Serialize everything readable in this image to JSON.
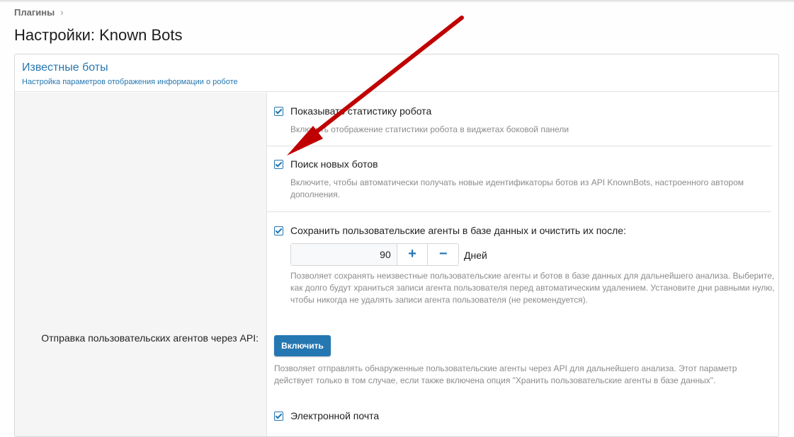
{
  "breadcrumb": {
    "item": "Плагины",
    "sep": "›"
  },
  "page": {
    "title": "Настройки: Known Bots"
  },
  "block": {
    "title": "Известные боты",
    "description": "Настройка параметров отображения информации о роботе"
  },
  "options": [
    {
      "label": "Показывать статистику робота",
      "hint": "Включить отображение статистики робота в виджетах боковой панели",
      "checked": true
    },
    {
      "label": "Поиск новых ботов",
      "hint": "Включите, чтобы автоматически получать новые идентификаторы ботов из API KnownBots, настроенного автором дополнения.",
      "checked": true
    },
    {
      "label": "Сохранить пользовательские агенты в базе данных и очистить их после:",
      "hint": "Позволяет сохранять неизвестные пользовательские агенты и ботов в базе данных для дальнейшего анализа. Выберите, как долго будут храниться записи агента пользователя перед автоматическим удалением. Установите дни равными нулю, чтобы никогда не удалять записи агента пользователя (не рекомендуется).",
      "checked": true
    }
  ],
  "retention": {
    "value": "90",
    "plus": "+",
    "minus": "−",
    "units": "Дней"
  },
  "api": {
    "label": "Отправка пользовательских агентов через API:",
    "button": "Включить",
    "hint": "Позволяет отправлять обнаруженные пользовательские агенты через API для дальнейшего анализа. Этот параметр действует только в том случае, если также включена опция \"Хранить пользовательские агенты в базе данных\"."
  },
  "email": {
    "label": "Электронной почта",
    "checked": true
  },
  "colors": {
    "accent": "#2577b1",
    "arrow": "#c00000"
  }
}
